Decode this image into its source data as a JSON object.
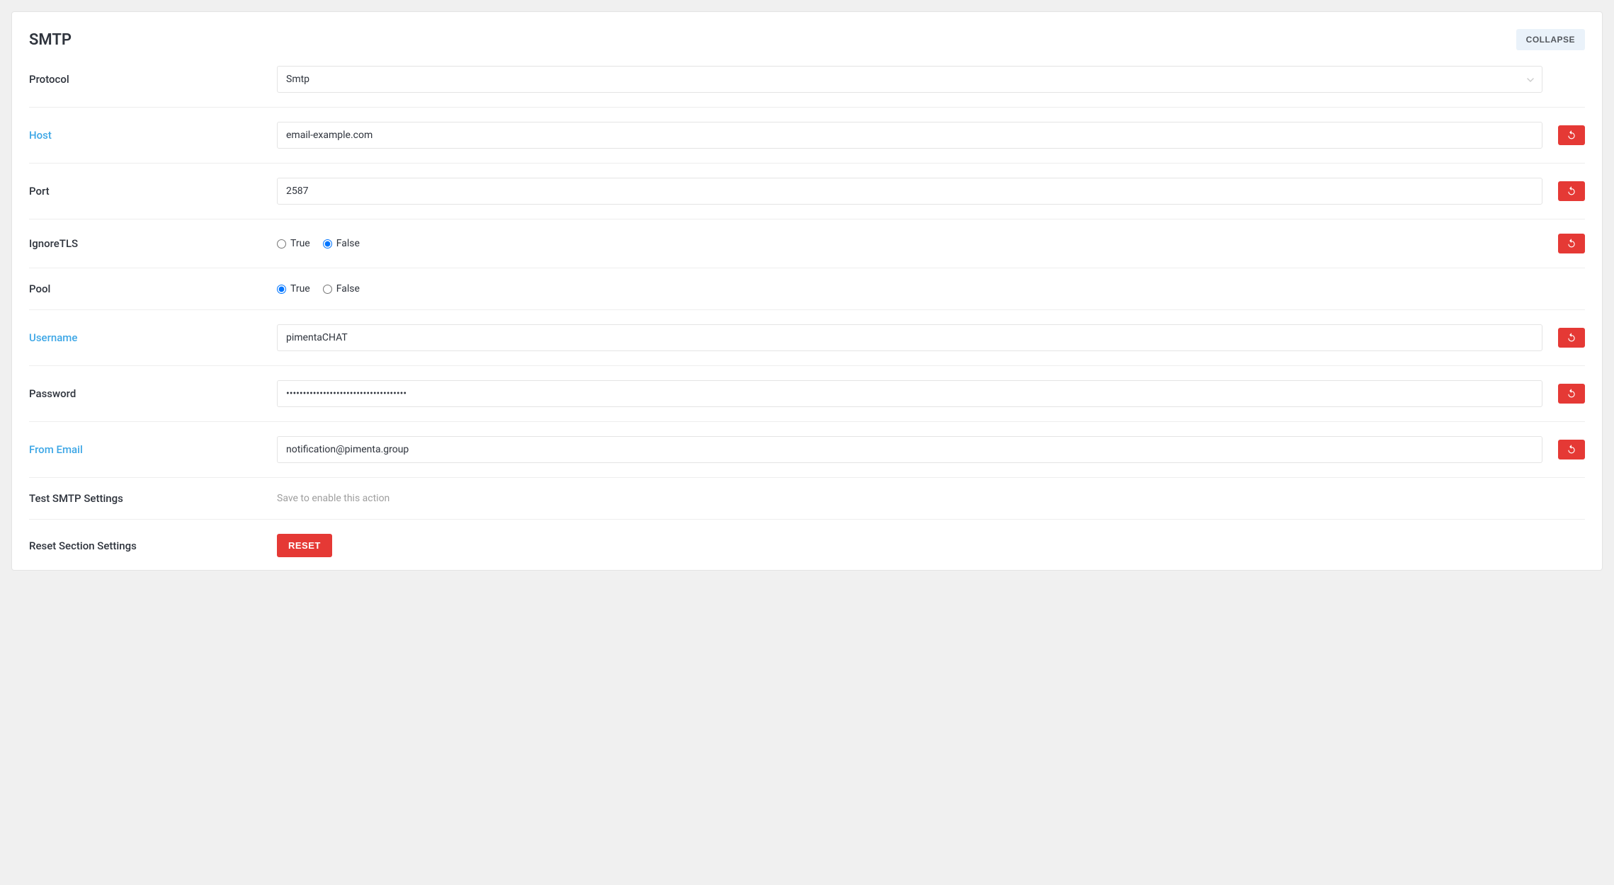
{
  "header": {
    "title": "SMTP",
    "collapse_label": "COLLAPSE"
  },
  "labels": {
    "protocol": "Protocol",
    "host": "Host",
    "port": "Port",
    "ignoretls": "IgnoreTLS",
    "pool": "Pool",
    "username": "Username",
    "password": "Password",
    "from_email": "From Email",
    "test_smtp": "Test SMTP Settings",
    "reset_section": "Reset Section Settings"
  },
  "values": {
    "protocol": "Smtp",
    "host": "email-example.com",
    "port": "2587",
    "ignoretls": "False",
    "pool": "True",
    "username": "pimentaCHAT",
    "password": "••••••••••••••••••••••••••••••••••••",
    "from_email": "notification@pimenta.group"
  },
  "radio": {
    "true": "True",
    "false": "False"
  },
  "hints": {
    "test_smtp": "Save to enable this action"
  },
  "buttons": {
    "reset": "RESET"
  }
}
